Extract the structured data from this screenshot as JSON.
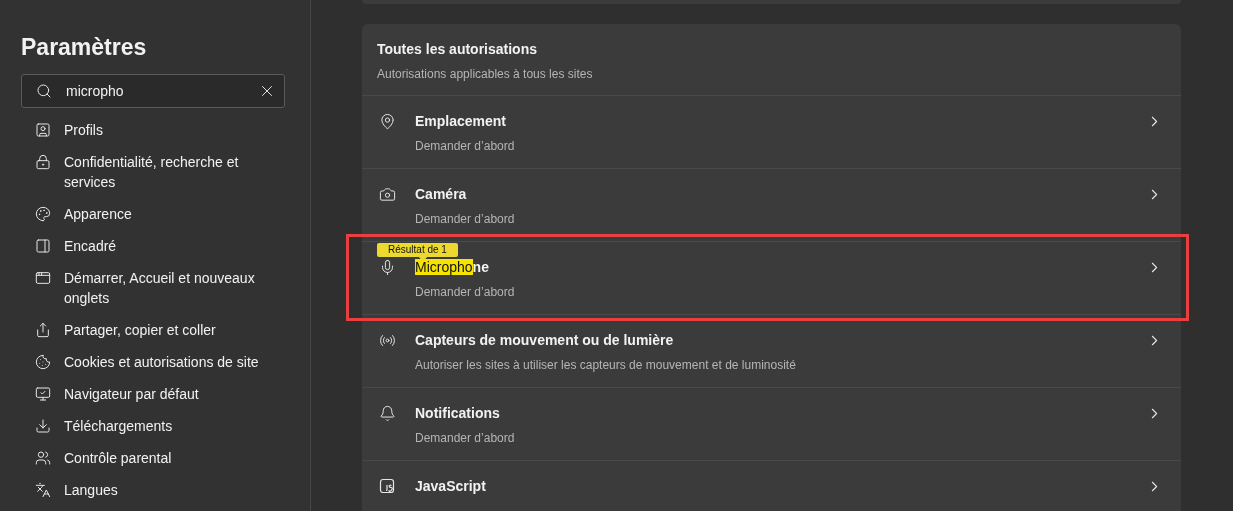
{
  "sidebar": {
    "title": "Paramètres",
    "search": {
      "value": "micropho"
    },
    "items": [
      {
        "label": "Profils",
        "kind": "profile"
      },
      {
        "label": "Confidentialité, recherche et services",
        "kind": "lock"
      },
      {
        "label": "Apparence",
        "kind": "palette"
      },
      {
        "label": "Encadré",
        "kind": "panel"
      },
      {
        "label": "Démarrer, Accueil et nouveaux onglets",
        "kind": "window"
      },
      {
        "label": "Partager, copier et coller",
        "kind": "share"
      },
      {
        "label": "Cookies et autorisations de site",
        "kind": "cookie"
      },
      {
        "label": "Navigateur par défaut",
        "kind": "browser"
      },
      {
        "label": "Téléchargements",
        "kind": "download"
      },
      {
        "label": "Contrôle parental",
        "kind": "family"
      },
      {
        "label": "Langues",
        "kind": "language"
      }
    ]
  },
  "permissions": {
    "title": "Toutes les autorisations",
    "subtitle": "Autorisations applicables à tous les sites",
    "rows": [
      {
        "kind": "location",
        "title": "Emplacement",
        "subtitle": "Demander d’abord",
        "outlined": false
      },
      {
        "kind": "camera",
        "title": "Caméra",
        "subtitle": "Demander d’abord",
        "outlined": false
      },
      {
        "kind": "mic",
        "title_match": "Micropho",
        "title": "ne",
        "subtitle": "Demander d’abord",
        "outlined": true,
        "tooltip": "Résultat de 1"
      },
      {
        "kind": "sensor",
        "title": "Capteurs de mouvement ou de lumière",
        "subtitle": "Autoriser les sites à utiliser les capteurs de mouvement et de luminosité",
        "outlined": false
      },
      {
        "kind": "bell",
        "title": "Notifications",
        "subtitle": "Demander d’abord",
        "outlined": false
      },
      {
        "kind": "js",
        "title": "JavaScript",
        "outlined": false
      }
    ]
  }
}
